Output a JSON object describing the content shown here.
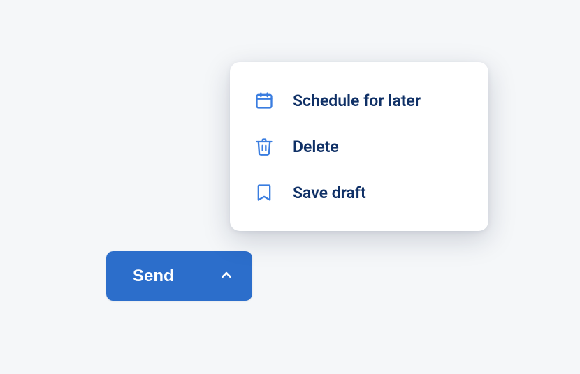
{
  "button": {
    "send_label": "Send"
  },
  "menu": {
    "items": [
      {
        "label": "Schedule for later"
      },
      {
        "label": "Delete"
      },
      {
        "label": "Save draft"
      }
    ]
  }
}
